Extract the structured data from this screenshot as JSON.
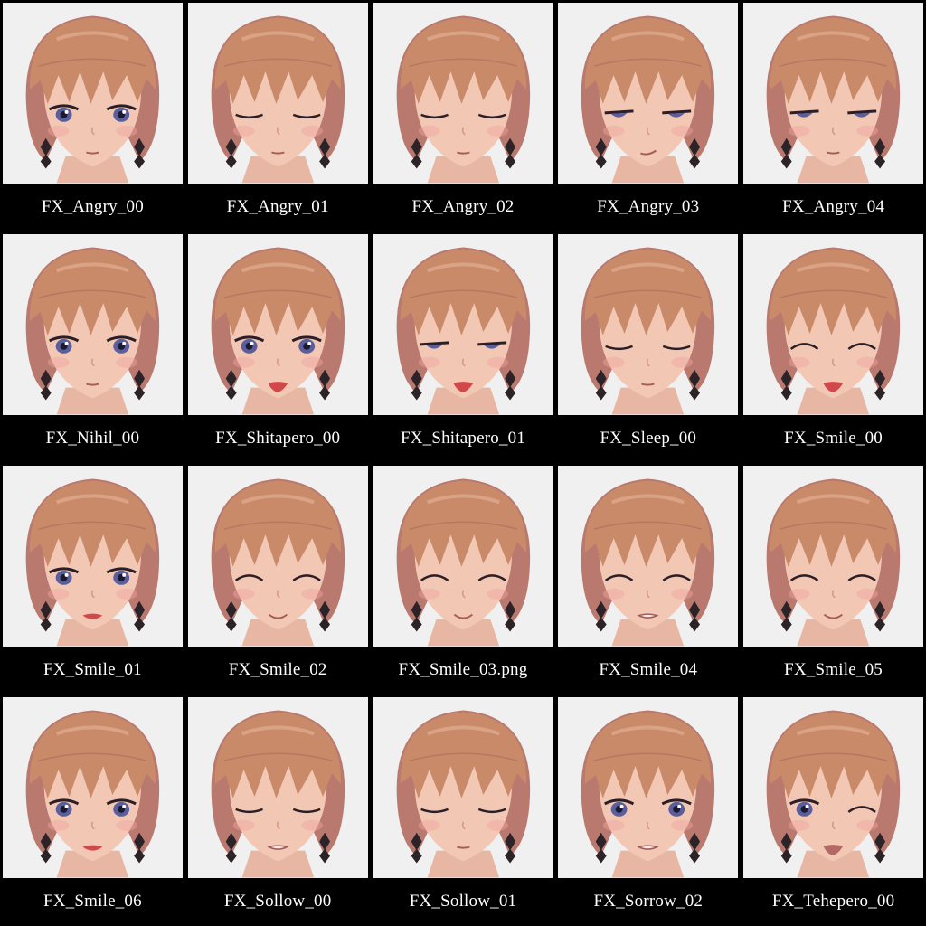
{
  "items": [
    {
      "label": "FX_Angry_00",
      "eyes": "open",
      "mouth": "neutral",
      "lips": false
    },
    {
      "label": "FX_Angry_01",
      "eyes": "closed",
      "mouth": "neutral",
      "lips": false
    },
    {
      "label": "FX_Angry_02",
      "eyes": "closed",
      "mouth": "neutral",
      "lips": false
    },
    {
      "label": "FX_Angry_03",
      "eyes": "half",
      "mouth": "smirk",
      "lips": false
    },
    {
      "label": "FX_Angry_04",
      "eyes": "half",
      "mouth": "neutral",
      "lips": false
    },
    {
      "label": "FX_Nihil_00",
      "eyes": "open",
      "mouth": "neutral",
      "lips": false
    },
    {
      "label": "FX_Shitapero_00",
      "eyes": "open",
      "mouth": "tongue",
      "lips": true
    },
    {
      "label": "FX_Shitapero_01",
      "eyes": "half",
      "mouth": "tongue",
      "lips": true
    },
    {
      "label": "FX_Sleep_00",
      "eyes": "closed",
      "mouth": "neutral",
      "lips": false
    },
    {
      "label": "FX_Smile_00",
      "eyes": "smile",
      "mouth": "tongue",
      "lips": true
    },
    {
      "label": "FX_Smile_01",
      "eyes": "open",
      "mouth": "open",
      "lips": true
    },
    {
      "label": "FX_Smile_02",
      "eyes": "smile",
      "mouth": "smile",
      "lips": false
    },
    {
      "label": "FX_Smile_03.png",
      "eyes": "smile",
      "mouth": "smile",
      "lips": false
    },
    {
      "label": "FX_Smile_04",
      "eyes": "smile",
      "mouth": "teeth",
      "lips": false
    },
    {
      "label": "FX_Smile_05",
      "eyes": "smile",
      "mouth": "smile",
      "lips": false
    },
    {
      "label": "FX_Smile_06",
      "eyes": "open",
      "mouth": "open",
      "lips": true
    },
    {
      "label": "FX_Sollow_00",
      "eyes": "closed",
      "mouth": "teeth",
      "lips": false
    },
    {
      "label": "FX_Sollow_01",
      "eyes": "closed",
      "mouth": "neutral",
      "lips": false
    },
    {
      "label": "FX_Sorrow_02",
      "eyes": "open",
      "mouth": "teeth",
      "lips": false
    },
    {
      "label": "FX_Tehepero_00",
      "eyes": "wink",
      "mouth": "tongue",
      "lips": false
    }
  ],
  "colors": {
    "background": "#000000",
    "thumb_bg": "#f0f0f0",
    "hair": "#c98a6a",
    "skin": "#f2c7b4",
    "eye_iris": "#5a5e9c",
    "lip": "#d0484a"
  }
}
